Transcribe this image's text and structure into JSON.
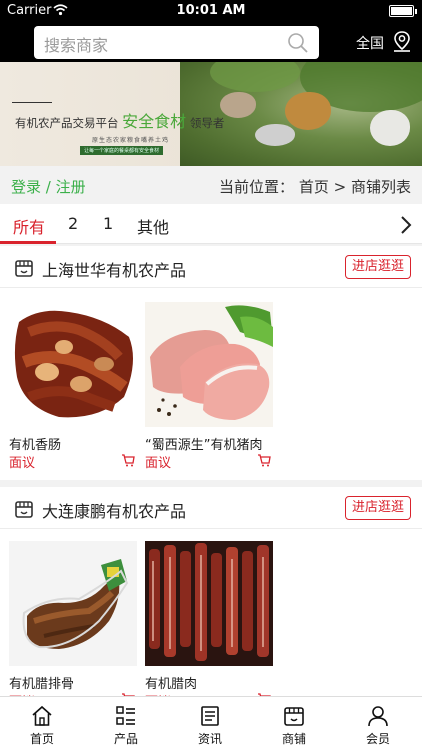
{
  "status_bar": {
    "carrier": "Carrier",
    "time": "10:01 AM",
    "battery_level": 1.0
  },
  "header": {
    "search_placeholder": "搜索商家",
    "region_label": "全国"
  },
  "banner": {
    "text_main": "有机农产品交易平台",
    "text_highlight": "安全食材",
    "text_tail": "领导者",
    "subtext": "原生态农家粮食嘴养土鸡",
    "strip": "让每一个家庭的餐桌都有安全食材"
  },
  "nav": {
    "login": "登录",
    "divider": "/",
    "register": "注册",
    "breadcrumb_prefix": "当前位置：",
    "breadcrumb_home": "首页",
    "breadcrumb_sep": ">",
    "breadcrumb_current": "商铺列表"
  },
  "tabs": [
    "所有",
    "2",
    "1",
    "其他"
  ],
  "shops": [
    {
      "name": "上海世华有机农产品",
      "enter_label": "进店逛逛",
      "products": [
        {
          "name": "有机香肠",
          "price": "面议"
        },
        {
          "name": "“蜀西源生”有机猪肉",
          "price": "面议"
        }
      ]
    },
    {
      "name": "大连康鹏有机农产品",
      "enter_label": "进店逛逛",
      "products": [
        {
          "name": "有机腊排骨",
          "price": "面议"
        },
        {
          "name": "有机腊肉",
          "price": "面议"
        }
      ]
    }
  ],
  "tabbar": [
    {
      "label": "首页",
      "icon": "home-icon"
    },
    {
      "label": "产品",
      "icon": "list-icon"
    },
    {
      "label": "资讯",
      "icon": "news-icon"
    },
    {
      "label": "商铺",
      "icon": "shop-icon"
    },
    {
      "label": "会员",
      "icon": "user-icon"
    }
  ],
  "colors": {
    "accent_red": "#d9232d",
    "login_green": "#3bb04a",
    "header_bg": "#000000"
  }
}
